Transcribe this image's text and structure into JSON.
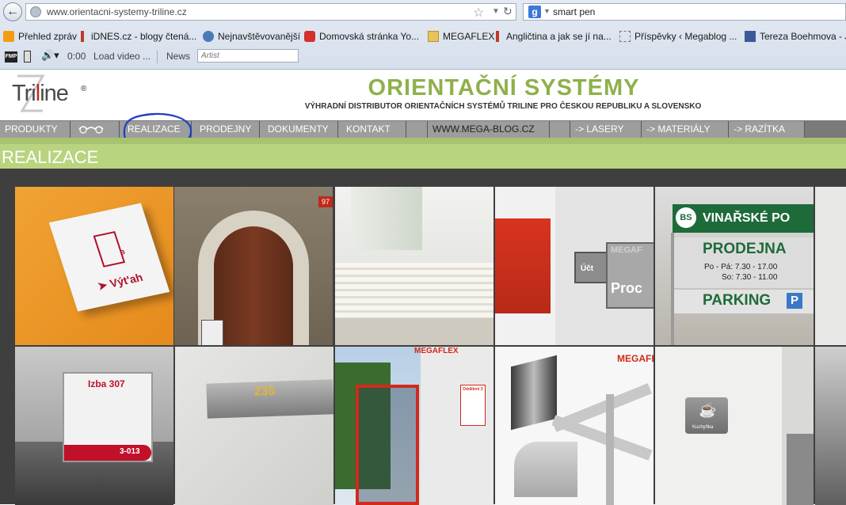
{
  "browser": {
    "url": "www.orientacni-systemy-triline.cz",
    "search_query": "smart pen",
    "search_engine_letter": "g",
    "bookmarks": [
      {
        "label": "Přehled zpráv",
        "icon": "rss-icon"
      },
      {
        "label": "iDNES.cz - blogy čtená...",
        "icon": "idnes-icon"
      },
      {
        "label": "Nejnavštěvovanější",
        "icon": "magnifier-icon"
      },
      {
        "label": "Domovská stránka Yo...",
        "icon": "youtube-icon"
      },
      {
        "label": "MEGAFLEX",
        "icon": "folder-icon"
      },
      {
        "label": "Angličtina a jak se jí na...",
        "icon": "idnes-icon"
      },
      {
        "label": "Příspěvky ‹ Megablog ...",
        "icon": "dashed-page-icon"
      },
      {
        "label": "Tereza Boehmova - Je...",
        "icon": "facebook-icon"
      }
    ],
    "toolbar": {
      "fmp_label": "FMP",
      "time": "0:00",
      "load_video": "Load video ...",
      "news": "News",
      "artist_placeholder": "Artist"
    }
  },
  "site": {
    "logo_text_start": "Tri",
    "logo_text_accent": "l",
    "logo_text_end": "ine",
    "logo_reg": "®",
    "title": "ORIENTAČNÍ SYSTÉMY",
    "subtitle": "VÝHRADNÍ DISTRIBUTOR ORIENTAČNÍCH SYSTÉMŮ TRILINE PRO ČESKOU REPUBLIKU A SLOVENSKO",
    "menu": [
      {
        "label": "PRODUKTY"
      },
      {
        "label": ""
      },
      {
        "label": "REALIZACE"
      },
      {
        "label": "PRODEJNY"
      },
      {
        "label": "DOKUMENTY"
      },
      {
        "label": "KONTAKT"
      },
      {
        "label": ""
      },
      {
        "label": "WWW.MEGA-BLOG.CZ"
      },
      {
        "label": ""
      },
      {
        "label": "-> LASERY"
      },
      {
        "label": "-> MATERIÁLY"
      },
      {
        "label": "-> RAZÍTKA"
      }
    ],
    "section_title": "REALIZACE",
    "gallery": {
      "tile1_text": "Výt'ah",
      "tile1_letter": "B",
      "tile3_number": "97",
      "tile5_brand": "VINAŘSKÉ PO",
      "tile5_logo": "BS",
      "tile5_shop": "PRODEJNA",
      "tile5_hours1": "Po - Pá: 7.30 - 17.00",
      "tile5_hours2": "So: 7.30 - 11.00",
      "tile5_parking": "PARKING",
      "tile5_parking_icon": "P",
      "tile4_sign1": "Proc",
      "tile4_sign2": "Účt",
      "tile4_sign3": "MEGAF",
      "tile6_room": "Izba 307",
      "tile6_code": "3-013",
      "tile7_number": "235",
      "tile8_brand": "MEGAFLEX",
      "tile8_sign": "Oddělení 3",
      "tile9_brand": "MEGAFLEX",
      "tile10_label": "Kuchyňka"
    }
  }
}
